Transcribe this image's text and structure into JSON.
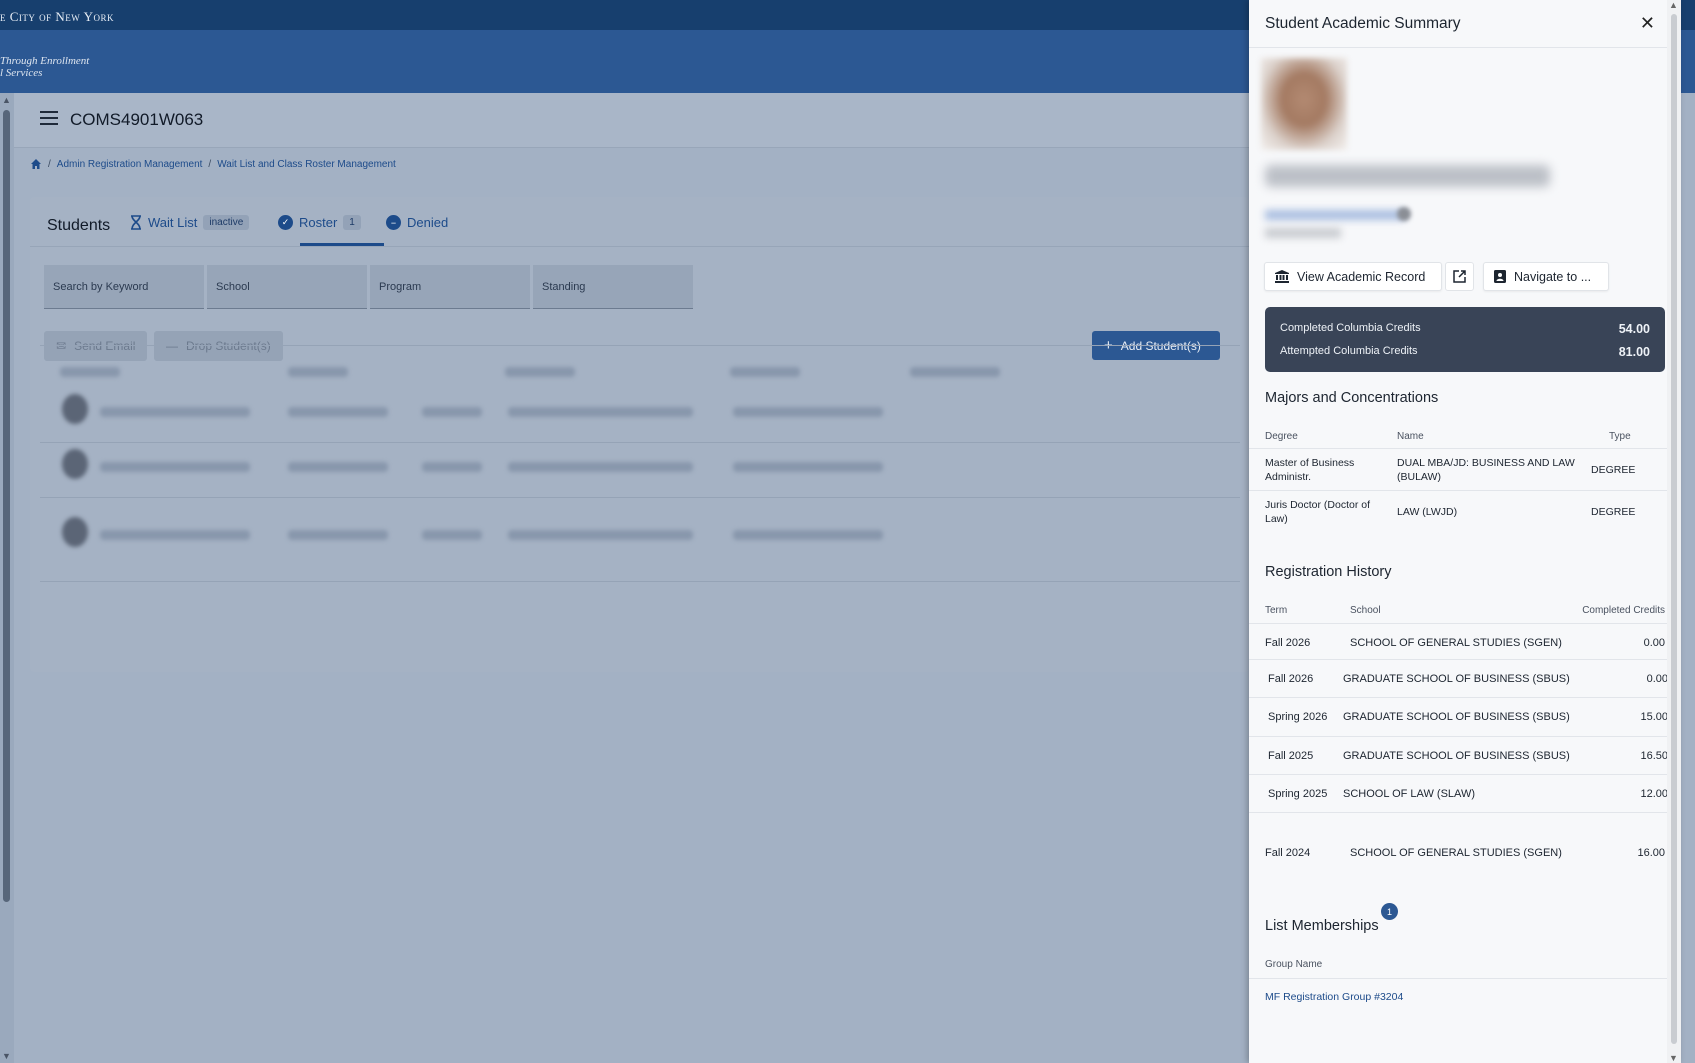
{
  "topbar": {
    "city": "e City of New York",
    "tagline_line1": "Through Enrollment",
    "tagline_line2": "l Services"
  },
  "header": {
    "course": "COMS4901W063"
  },
  "breadcrumb": {
    "item1": "Admin Registration Management",
    "item2": "Wait List and Class Roster Management"
  },
  "tabs": {
    "students": "Students",
    "waitlist": "Wait List",
    "waitlist_badge": "inactive",
    "roster": "Roster",
    "roster_count": "1",
    "denied": "Denied"
  },
  "filters": {
    "keyword": "Search by Keyword",
    "school": "School",
    "program": "Program",
    "standing": "Standing"
  },
  "actions": {
    "send_email": "Send Email",
    "drop": "Drop Student(s)",
    "add": "Add Student(s)"
  },
  "panel": {
    "title": "Student Academic Summary",
    "view_record": "View Academic Record",
    "navigate": "Navigate to ...",
    "credits": {
      "completed_label": "Completed Columbia Credits",
      "completed_value": "54.00",
      "attempted_label": "Attempted Columbia Credits",
      "attempted_value": "81.00"
    },
    "majors": {
      "title": "Majors and Concentrations",
      "headers": {
        "degree": "Degree",
        "name": "Name",
        "type": "Type"
      },
      "rows": [
        {
          "degree": "Master of Business Administr.",
          "name": "DUAL MBA/JD: BUSINESS AND LAW (BULAW)",
          "type": "DEGREE"
        },
        {
          "degree": "Juris Doctor (Doctor of Law)",
          "name": "LAW (LWJD)",
          "type": "DEGREE"
        }
      ]
    },
    "registration": {
      "title": "Registration History",
      "headers": {
        "term": "Term",
        "school": "School",
        "credits": "Completed Credits"
      },
      "rows": [
        {
          "term": "Fall 2026",
          "school": "SCHOOL OF GENERAL STUDIES (SGEN)",
          "credits": "0.00"
        },
        {
          "term": "Fall 2026",
          "school": "GRADUATE SCHOOL OF BUSINESS (SBUS)",
          "credits": "0.00"
        },
        {
          "term": "Spring 2026",
          "school": "GRADUATE SCHOOL OF BUSINESS (SBUS)",
          "credits": "15.00"
        },
        {
          "term": "Fall 2025",
          "school": "GRADUATE SCHOOL OF BUSINESS (SBUS)",
          "credits": "16.50"
        },
        {
          "term": "Spring 2025",
          "school": "SCHOOL OF LAW (SLAW)",
          "credits": "12.00"
        },
        {
          "term": "Fall 2024",
          "school": "SCHOOL OF GENERAL STUDIES (SGEN)",
          "credits": "16.00"
        }
      ]
    },
    "memberships": {
      "title": "List Memberships",
      "badge": "1",
      "header": "Group Name",
      "group": "MF Registration Group #3204"
    }
  }
}
